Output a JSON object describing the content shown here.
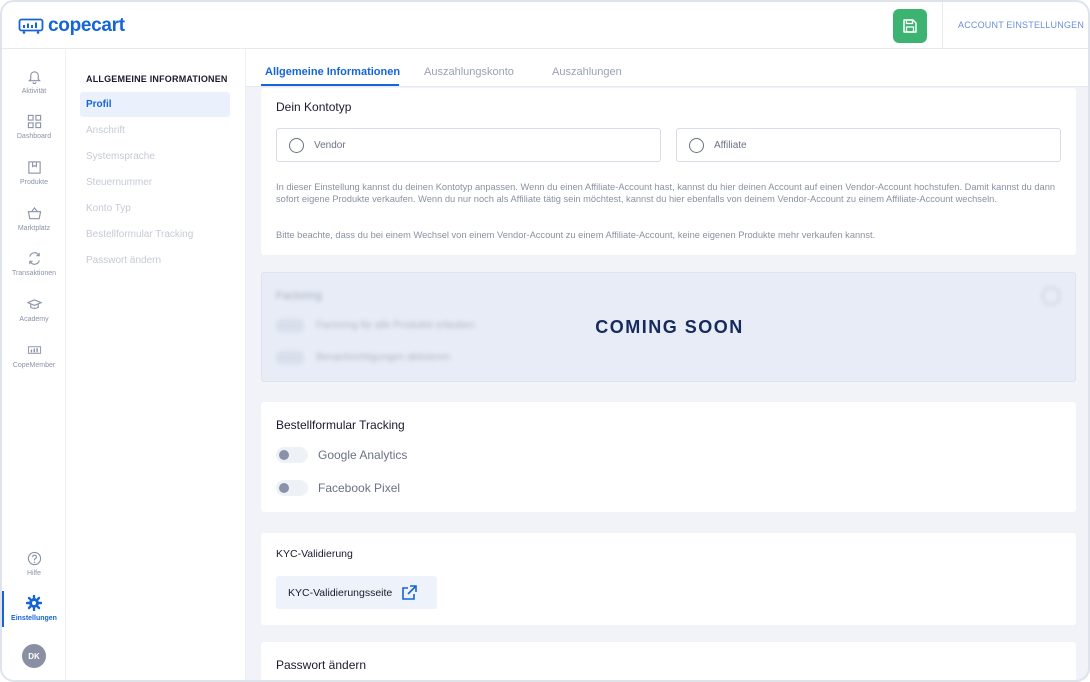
{
  "header": {
    "logo_text": "copecart",
    "save_icon": "save-icon",
    "account_link": "ACCOUNT EINSTELLUNGEN"
  },
  "rail": {
    "items": [
      {
        "label": "Aktivität",
        "icon": "bell-icon"
      },
      {
        "label": "Dashboard",
        "icon": "grid-icon"
      },
      {
        "label": "Produkte",
        "icon": "box-icon"
      },
      {
        "label": "Marktplatz",
        "icon": "basket-icon"
      },
      {
        "label": "Transaktionen",
        "icon": "exchange-icon"
      },
      {
        "label": "Academy",
        "icon": "graduation-cap-icon"
      },
      {
        "label": "CopeMember",
        "icon": "chart-icon"
      }
    ],
    "bottom": [
      {
        "label": "Hilfe",
        "icon": "help-icon"
      },
      {
        "label": "Einstellungen",
        "icon": "gear-icon"
      }
    ],
    "avatar_initials": "DK",
    "accent": "#1565d8"
  },
  "subnav": {
    "title": "ALLGEMEINE INFORMATIONEN",
    "items": [
      {
        "label": "Profil"
      },
      {
        "label": "Anschrift"
      },
      {
        "label": "Systemsprache"
      },
      {
        "label": "Steuernummer"
      },
      {
        "label": "Konto Typ"
      },
      {
        "label": "Bestellformular Tracking"
      },
      {
        "label": "Passwort ändern"
      }
    ]
  },
  "tabs": [
    {
      "label": "Allgemeine Informationen"
    },
    {
      "label": "Auszahlungskonto"
    },
    {
      "label": "Auszahlungen"
    }
  ],
  "kontotyp": {
    "title": "Dein Kontotyp",
    "options": [
      {
        "label": "Vendor"
      },
      {
        "label": "Affiliate"
      }
    ],
    "info1": "In dieser Einstellung kannst du deinen Kontotyp anpassen. Wenn du einen Affiliate-Account hast, kannst du hier deinen Account auf einen Vendor-Account hochstufen. Damit kannst du dann sofort eigene Produkte verkaufen. Wenn du nur noch als Affiliate tätig sein möchtest, kannst du hier ebenfalls von deinem Vendor-Account zu einem Affiliate-Account wechseln.",
    "info2": "Bitte beachte, dass du bei einem Wechsel von einem Vendor-Account zu einem Affiliate-Account, keine eigenen Produkte mehr verkaufen kannst."
  },
  "factoring": {
    "title": "Factoring",
    "option1": "Factoring für alle Produkte erlauben",
    "option2": "Benachrichtigungen aktivieren",
    "coming_soon": "COMING SOON"
  },
  "tracking": {
    "title": "Bestellformular Tracking",
    "options": [
      {
        "label": "Google Analytics"
      },
      {
        "label": "Facebook Pixel"
      }
    ]
  },
  "kyc": {
    "title": "KYC-Validierung",
    "button": "KYC-Validierungsseite"
  },
  "password": {
    "title": "Passwort ändern"
  }
}
